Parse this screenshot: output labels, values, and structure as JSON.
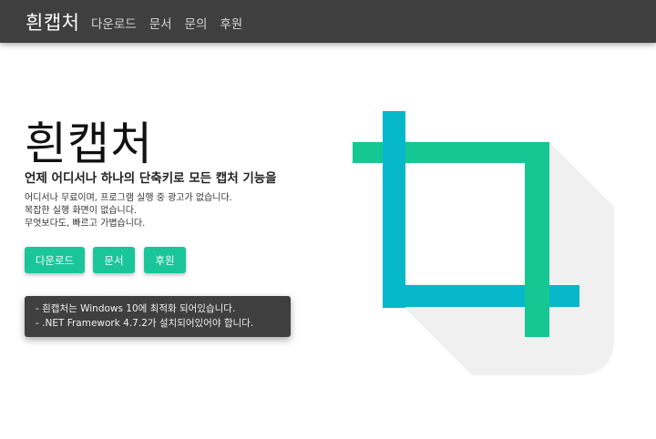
{
  "nav": {
    "brand": "흰캡처",
    "links": [
      "다운로드",
      "문서",
      "문의",
      "후원"
    ]
  },
  "hero": {
    "title": "흰캡처",
    "subtitle": "언제 어디서나 하나의 단축키로 모든 캡처 기능을",
    "description": [
      "어디서나 무료이며, 프로그램 실행 중 광고가 없습니다.",
      "복잡한 실행 화면이 없습니다.",
      "무엇보다도, 빠르고 가볍습니다."
    ],
    "buttons": {
      "download": "다운로드",
      "docs": "문서",
      "donate": "후원"
    }
  },
  "notice": {
    "lines": [
      "- 흰캡처는 Windows 10에 최적화 되어있습니다.",
      "- .NET Framework 4.7.2가 설치되어있어야 합니다."
    ]
  },
  "logo": {
    "icon": "crop-icon",
    "colors": {
      "green": "#14c793",
      "blue": "#06b7c9",
      "shadow": "#f0f0f0"
    }
  },
  "colors": {
    "navbar": "#3f3f3f",
    "accent": "#1bc59a",
    "notice_bg": "#3f3f3f"
  }
}
